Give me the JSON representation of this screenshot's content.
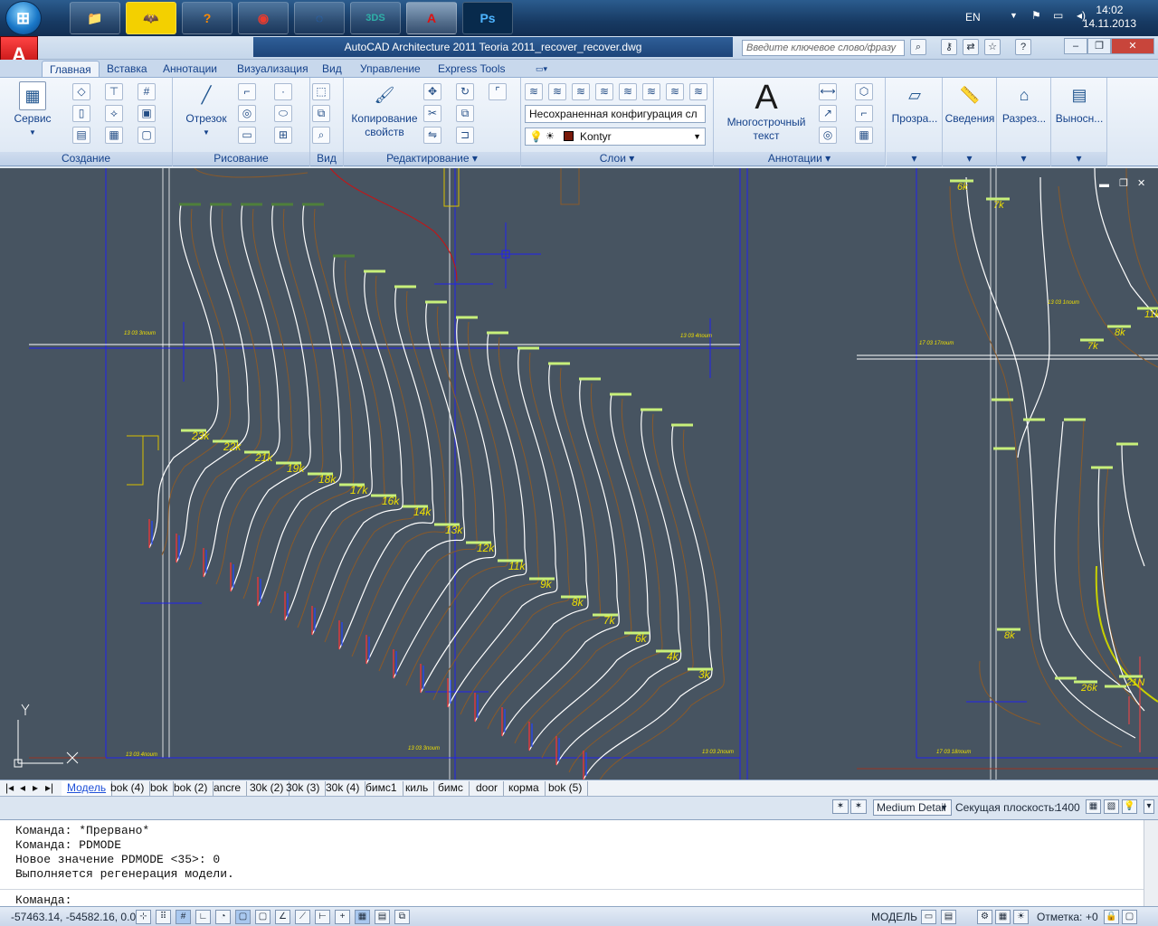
{
  "taskbar": {
    "start_glyph": "⊞",
    "apps": [
      {
        "name": "explorer",
        "glyph": "📁"
      },
      {
        "name": "batman",
        "glyph": "🦇"
      },
      {
        "name": "help",
        "glyph": "?"
      },
      {
        "name": "chrome",
        "glyph": "◉"
      },
      {
        "name": "spinner",
        "glyph": "◌"
      },
      {
        "name": "3ds",
        "glyph": "3DS"
      },
      {
        "name": "autocad",
        "glyph": "A"
      },
      {
        "name": "photoshop",
        "glyph": "Ps"
      }
    ],
    "language": "EN",
    "time": "14:02",
    "date": "14.11.2013"
  },
  "window": {
    "title": "AutoCAD Architecture 2011    Teoria 2011_recover_recover.dwg",
    "search_placeholder": "Введите ключевое слово/фразу",
    "app_button": "A"
  },
  "ribbon": {
    "tabs": [
      "Главная",
      "Вставка",
      "Аннотации",
      "Визуализация",
      "Вид",
      "Управление",
      "Express Tools"
    ],
    "selected_tab": 0,
    "panels": {
      "create": {
        "label": "Создание",
        "service": "Сервис"
      },
      "draw": {
        "label": "Рисование",
        "segment": "Отрезок"
      },
      "view": {
        "label": "Вид"
      },
      "edit": {
        "label": "Редактирование",
        "copy_props": "Копирование свойств"
      },
      "layers": {
        "label": "Слои",
        "config": "Несохраненная конфигурация сл",
        "current_layer": "Kontyr",
        "layer_color": "#7a1a0a"
      },
      "annotations": {
        "label": "Аннотации",
        "mtext": "Многострочный текст",
        "mtext_glyph": "A"
      },
      "extra": [
        "Прозра...",
        "Сведения",
        "Разрез...",
        "Выносн..."
      ]
    }
  },
  "drawing": {
    "background": "#475461",
    "curve_labels": [
      "23k",
      "22k",
      "21k",
      "19k",
      "18k",
      "17k",
      "16k",
      "14k",
      "13k",
      "12k",
      "11k",
      "9k",
      "8k",
      "7k",
      "6k",
      "4k",
      "3k"
    ],
    "right_labels": [
      "6k",
      "7k",
      "7k",
      "8k",
      "11k",
      "8k",
      "26k",
      "21N"
    ],
    "small_notes": [
      "13 03 3поит",
      "13 03 4поит",
      "13 03 4поит",
      "13 03 3поит",
      "13 03 2поит",
      "13 03 1поит",
      "17 03 17поит",
      "17 03 18поит",
      "17 03 15поит"
    ]
  },
  "layout_tabs": [
    "Модель",
    "bok (4)",
    "bok",
    "bok (2)",
    "ancre",
    "30k (2)",
    "30k (3)",
    "30k (4)",
    "бимс1",
    "киль",
    "бимс",
    "door",
    "корма",
    "bok (5)"
  ],
  "annotation_bar": {
    "detail": "Medium Detail",
    "section_label": "Секущая плоскость:",
    "section_value": "1400"
  },
  "command": {
    "history": [
      "Команда: *Прервано*",
      "Команда: PDMODE",
      "Новое значение PDMODE <35>: 0",
      "Выполняется регенерация модели."
    ],
    "prompt": "Команда:"
  },
  "status": {
    "coords": "-57463.14, -54582.16, 0.00",
    "model": "МОДЕЛЬ",
    "elevation_label": "Отметка:",
    "elevation_value": "+0"
  }
}
